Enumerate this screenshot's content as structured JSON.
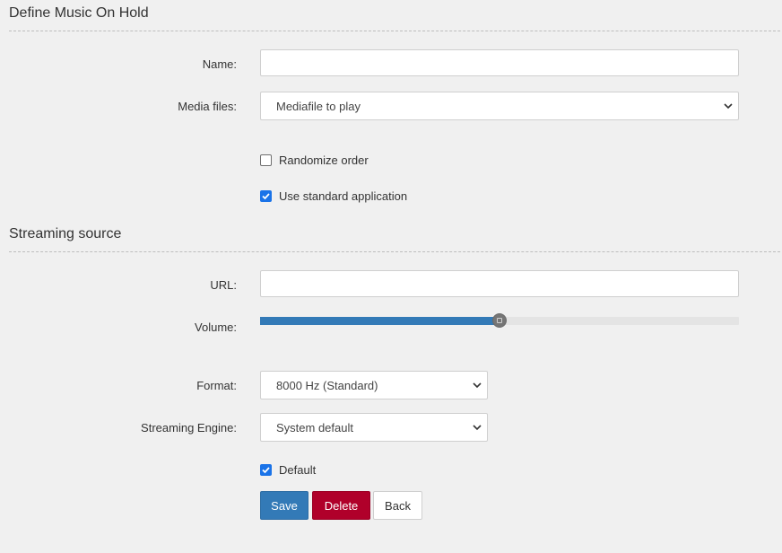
{
  "sections": {
    "moh_title": "Define Music On Hold",
    "streaming_title": "Streaming source"
  },
  "form": {
    "name": {
      "label": "Name:",
      "value": ""
    },
    "media_files": {
      "label": "Media files:",
      "selected": "Mediafile to play"
    },
    "randomize": {
      "label": "Randomize order",
      "checked": false
    },
    "standard_app": {
      "label": "Use standard application",
      "checked": true
    }
  },
  "streaming": {
    "url": {
      "label": "URL:",
      "value": ""
    },
    "volume": {
      "label": "Volume:",
      "level_percent": 50
    },
    "format": {
      "label": "Format:",
      "selected": "8000 Hz (Standard)"
    },
    "engine": {
      "label": "Streaming Engine:",
      "selected": "System default"
    },
    "default": {
      "label": "Default",
      "checked": true
    }
  },
  "buttons": {
    "save": "Save",
    "delete": "Delete",
    "back": "Back"
  },
  "colors": {
    "primary": "#337ab7",
    "danger": "#b0002a",
    "checkbox": "#1a73e8",
    "background": "#f0f0f0"
  }
}
